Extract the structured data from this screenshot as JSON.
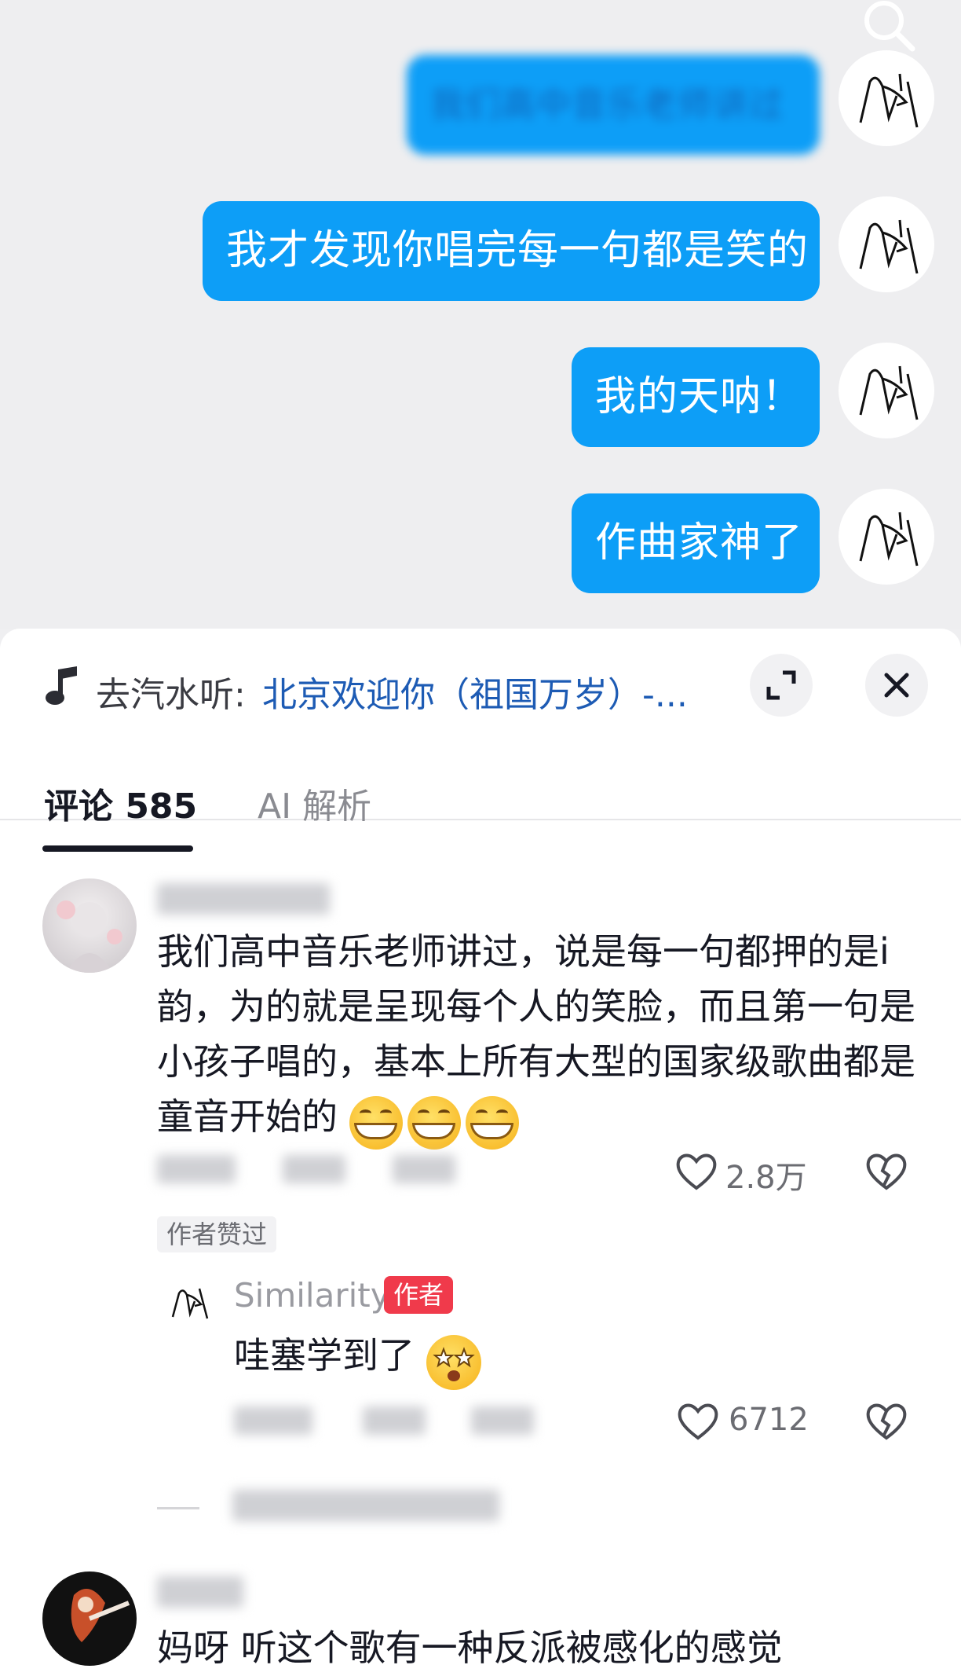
{
  "chat": {
    "messages": [
      {
        "text": "我们高中音乐老师讲过",
        "blurred": true
      },
      {
        "text": "我才发现你唱完每一句都是笑的",
        "blurred": false
      },
      {
        "text": "我的天呐！",
        "blurred": false
      },
      {
        "text": "作曲家神了",
        "blurred": false
      }
    ]
  },
  "music_bar": {
    "prefix": "去汽水听: ",
    "title": "北京欢迎你（祖国万岁）-..."
  },
  "tabs": {
    "comments": "评论 585",
    "ai": "AI 解析"
  },
  "comments": [
    {
      "text": "我们高中音乐老师讲过，说是每一句都押的是i韵，为的就是呈现每个人的笑脸，而且第一句是小孩子唱的，基本上所有大型的国家级歌曲都是童音开始的",
      "likes": "2.8万",
      "tag": "作者赞过",
      "reply": {
        "name": "Similarity",
        "badge": "作者",
        "text": "哇塞学到了",
        "likes": "6712"
      }
    },
    {
      "text": "妈呀 听这个歌有一种反派被感化的感觉"
    }
  ],
  "icons": {
    "search": "search-icon",
    "music": "music-note-icon",
    "expand": "expand-icon",
    "close": "close-icon",
    "like": "heart-icon",
    "dislike": "broken-heart-icon"
  },
  "colors": {
    "bubble": "#0d9ef7",
    "link": "#1d5bb4",
    "author_badge": "#f03a4b"
  }
}
